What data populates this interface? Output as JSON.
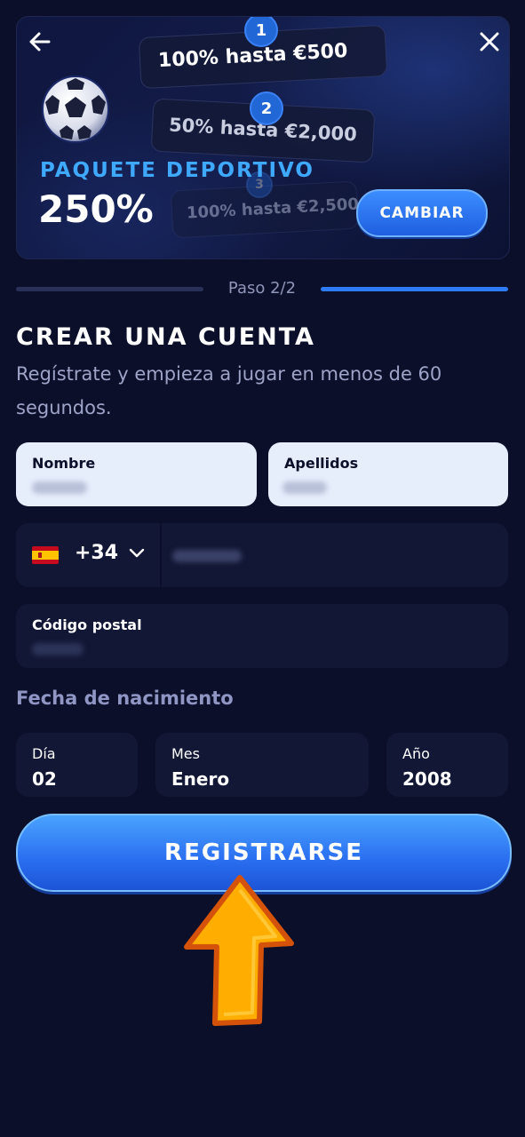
{
  "banner": {
    "tiers": [
      {
        "number": "1",
        "text": "100% hasta €500"
      },
      {
        "number": "2",
        "text": "50% hasta €2,000"
      },
      {
        "number": "3",
        "text": "100% hasta €2,500"
      }
    ],
    "package_title": "PAQUETE DEPORTIVO",
    "package_percent": "250%",
    "change_button": "CAMBIAR"
  },
  "progress": {
    "step_label": "Paso 2/2"
  },
  "form": {
    "heading": "CREAR UNA CUENTA",
    "subheading": "Regístrate y empieza a jugar en menos de 60 segundos.",
    "first_name_label": "Nombre",
    "last_name_label": "Apellidos",
    "phone_code": "+34",
    "postal_label": "Código postal",
    "dob_label": "Fecha de nacimiento",
    "day_label": "Día",
    "day_value": "02",
    "month_label": "Mes",
    "month_value": "Enero",
    "year_label": "Año",
    "year_value": "2008",
    "register_button": "REGISTRARSE"
  },
  "colors": {
    "background": "#0b0f2a",
    "accent_blue": "#2d7cf6",
    "package_title": "#3fa8ff",
    "arrow": "#ffae00"
  },
  "icons": [
    "back-arrow-icon",
    "close-icon",
    "soccer-ball-icon",
    "spain-flag-icon",
    "chevron-down-icon",
    "pointer-arrow-icon"
  ]
}
